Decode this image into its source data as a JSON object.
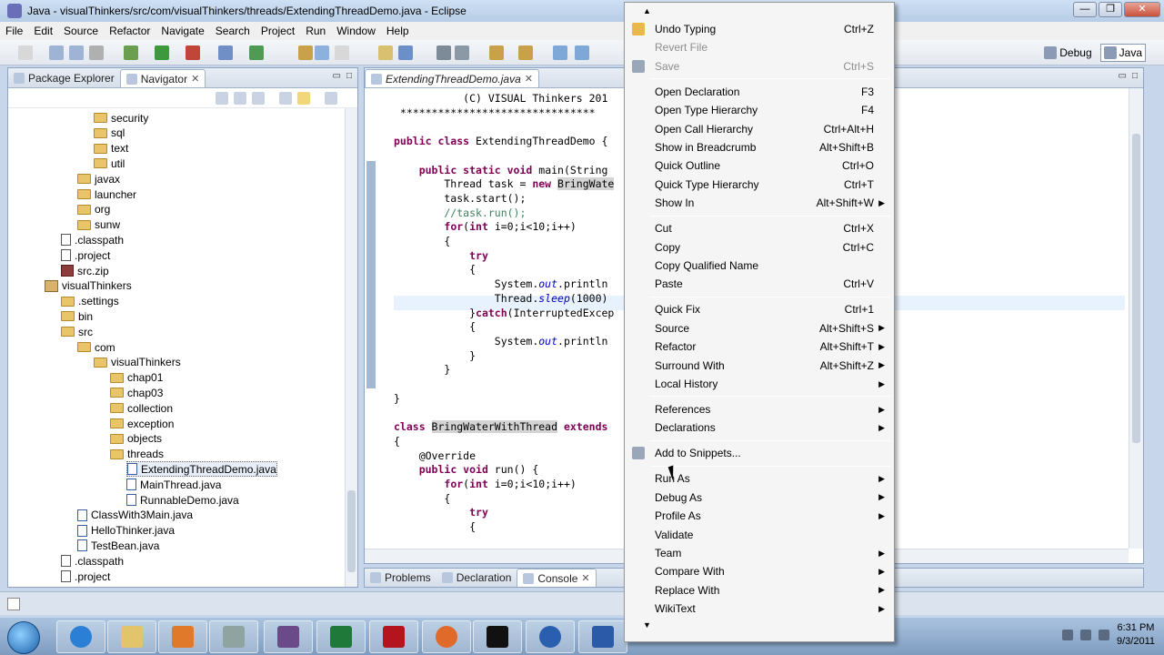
{
  "window": {
    "title": "Java - visualThinkers/src/com/visualThinkers/threads/ExtendingThreadDemo.java - Eclipse",
    "min": "—",
    "max": "❐",
    "close": "✕"
  },
  "menubar": [
    "File",
    "Edit",
    "Source",
    "Refactor",
    "Navigate",
    "Search",
    "Project",
    "Run",
    "Window",
    "Help"
  ],
  "perspectives": {
    "debug": "Debug",
    "java": "Java"
  },
  "left_panel": {
    "tabs": [
      {
        "label": "Package Explorer",
        "active": false
      },
      {
        "label": "Navigator",
        "active": true
      }
    ],
    "tree": [
      {
        "label": "security",
        "type": "folder",
        "indent": 4
      },
      {
        "label": "sql",
        "type": "folder",
        "indent": 4
      },
      {
        "label": "text",
        "type": "folder",
        "indent": 4
      },
      {
        "label": "util",
        "type": "folder",
        "indent": 4
      },
      {
        "label": "javax",
        "type": "folder",
        "indent": 3
      },
      {
        "label": "launcher",
        "type": "folder",
        "indent": 3
      },
      {
        "label": "org",
        "type": "folder",
        "indent": 3
      },
      {
        "label": "sunw",
        "type": "folder",
        "indent": 3
      },
      {
        "label": ".classpath",
        "type": "file",
        "indent": 2
      },
      {
        "label": ".project",
        "type": "file",
        "indent": 2
      },
      {
        "label": "src.zip",
        "type": "zip",
        "indent": 2
      },
      {
        "label": "visualThinkers",
        "type": "project",
        "indent": 1
      },
      {
        "label": ".settings",
        "type": "folder",
        "indent": 2
      },
      {
        "label": "bin",
        "type": "folder",
        "indent": 2
      },
      {
        "label": "src",
        "type": "folder",
        "indent": 2
      },
      {
        "label": "com",
        "type": "folder",
        "indent": 3
      },
      {
        "label": "visualThinkers",
        "type": "folder",
        "indent": 4
      },
      {
        "label": "chap01",
        "type": "folder",
        "indent": 5
      },
      {
        "label": "chap03",
        "type": "folder",
        "indent": 5
      },
      {
        "label": "collection",
        "type": "folder",
        "indent": 5
      },
      {
        "label": "exception",
        "type": "folder",
        "indent": 5
      },
      {
        "label": "objects",
        "type": "folder",
        "indent": 5
      },
      {
        "label": "threads",
        "type": "folder",
        "indent": 5
      },
      {
        "label": "ExtendingThreadDemo.java",
        "type": "java",
        "indent": 6,
        "selected": true
      },
      {
        "label": "MainThread.java",
        "type": "java",
        "indent": 6
      },
      {
        "label": "RunnableDemo.java",
        "type": "java",
        "indent": 6
      },
      {
        "label": "ClassWith3Main.java",
        "type": "java",
        "indent": 3
      },
      {
        "label": "HelloThinker.java",
        "type": "java",
        "indent": 3
      },
      {
        "label": "TestBean.java",
        "type": "java",
        "indent": 3
      },
      {
        "label": ".classpath",
        "type": "file",
        "indent": 2
      },
      {
        "label": ".project",
        "type": "file",
        "indent": 2
      }
    ]
  },
  "editor": {
    "tab": "ExtendingThreadDemo.java",
    "lines": [
      [
        {
          "t": "           (C) VISUAL Thinkers 201",
          "c": ""
        }
      ],
      [
        {
          "t": " *******************************",
          "c": ""
        }
      ],
      [],
      [
        {
          "t": "public class ",
          "c": "kw"
        },
        {
          "t": "ExtendingThreadDemo {",
          "c": ""
        }
      ],
      [],
      [
        {
          "t": "    ",
          "c": ""
        },
        {
          "t": "public static void ",
          "c": "kw"
        },
        {
          "t": "main(String",
          "c": ""
        }
      ],
      [
        {
          "t": "        Thread task = ",
          "c": ""
        },
        {
          "t": "new ",
          "c": "kw"
        },
        {
          "t": "BringWate",
          "c": "hl"
        }
      ],
      [
        {
          "t": "        task.start();",
          "c": ""
        }
      ],
      [
        {
          "t": "        //task.run();",
          "c": "cm"
        }
      ],
      [
        {
          "t": "        ",
          "c": ""
        },
        {
          "t": "for",
          "c": "kw"
        },
        {
          "t": "(",
          "c": ""
        },
        {
          "t": "int ",
          "c": "kw"
        },
        {
          "t": "i=0;i<10;i++)",
          "c": ""
        }
      ],
      [
        {
          "t": "        {",
          "c": ""
        }
      ],
      [
        {
          "t": "            ",
          "c": ""
        },
        {
          "t": "try",
          "c": "kw"
        }
      ],
      [
        {
          "t": "            {",
          "c": ""
        }
      ],
      [
        {
          "t": "                System.",
          "c": ""
        },
        {
          "t": "out",
          "c": "fld"
        },
        {
          "t": ".println",
          "c": ""
        }
      ],
      [
        {
          "t": "                Thread.",
          "c": ""
        },
        {
          "t": "sleep",
          "c": "fld"
        },
        {
          "t": "(1000)",
          "c": ""
        }
      ],
      [
        {
          "t": "            }",
          "c": ""
        },
        {
          "t": "catch",
          "c": "kw"
        },
        {
          "t": "(InterruptedExcep",
          "c": ""
        }
      ],
      [
        {
          "t": "            {",
          "c": ""
        }
      ],
      [
        {
          "t": "                System.",
          "c": ""
        },
        {
          "t": "out",
          "c": "fld"
        },
        {
          "t": ".println",
          "c": ""
        }
      ],
      [
        {
          "t": "            }",
          "c": ""
        }
      ],
      [
        {
          "t": "        }",
          "c": ""
        }
      ],
      [],
      [
        {
          "t": "}",
          "c": ""
        }
      ],
      [],
      [
        {
          "t": "class ",
          "c": "kw"
        },
        {
          "t": "BringWaterWithThread",
          "c": "hl"
        },
        {
          "t": " ",
          "c": ""
        },
        {
          "t": "extends",
          "c": "kw"
        }
      ],
      [
        {
          "t": "{",
          "c": ""
        }
      ],
      [
        {
          "t": "    @Override",
          "c": ""
        }
      ],
      [
        {
          "t": "    ",
          "c": ""
        },
        {
          "t": "public void ",
          "c": "kw"
        },
        {
          "t": "run() {",
          "c": ""
        }
      ],
      [
        {
          "t": "        ",
          "c": ""
        },
        {
          "t": "for",
          "c": "kw"
        },
        {
          "t": "(",
          "c": ""
        },
        {
          "t": "int ",
          "c": "kw"
        },
        {
          "t": "i=0;i<10;i++)",
          "c": ""
        }
      ],
      [
        {
          "t": "        {",
          "c": ""
        }
      ],
      [
        {
          "t": "            ",
          "c": ""
        },
        {
          "t": "try",
          "c": "kw"
        }
      ],
      [
        {
          "t": "            {",
          "c": ""
        }
      ]
    ]
  },
  "bottom_panel": {
    "tabs": [
      {
        "label": "Problems"
      },
      {
        "label": "Declaration"
      },
      {
        "label": "Console",
        "active": true
      }
    ]
  },
  "context_menu": {
    "top_arrow": "▲",
    "bottom_arrow": "▼",
    "groups": [
      [
        {
          "label": "Undo Typing",
          "shortcut": "Ctrl+Z",
          "icon": "undo-icon"
        },
        {
          "label": "Revert File",
          "disabled": true
        },
        {
          "label": "Save",
          "shortcut": "Ctrl+S",
          "disabled": true,
          "icon": "save-icon"
        }
      ],
      [
        {
          "label": "Open Declaration",
          "shortcut": "F3"
        },
        {
          "label": "Open Type Hierarchy",
          "shortcut": "F4"
        },
        {
          "label": "Open Call Hierarchy",
          "shortcut": "Ctrl+Alt+H"
        },
        {
          "label": "Show in Breadcrumb",
          "shortcut": "Alt+Shift+B"
        },
        {
          "label": "Quick Outline",
          "shortcut": "Ctrl+O"
        },
        {
          "label": "Quick Type Hierarchy",
          "shortcut": "Ctrl+T"
        },
        {
          "label": "Show In",
          "shortcut": "Alt+Shift+W",
          "submenu": true
        }
      ],
      [
        {
          "label": "Cut",
          "shortcut": "Ctrl+X"
        },
        {
          "label": "Copy",
          "shortcut": "Ctrl+C"
        },
        {
          "label": "Copy Qualified Name"
        },
        {
          "label": "Paste",
          "shortcut": "Ctrl+V"
        }
      ],
      [
        {
          "label": "Quick Fix",
          "shortcut": "Ctrl+1"
        },
        {
          "label": "Source",
          "shortcut": "Alt+Shift+S",
          "submenu": true
        },
        {
          "label": "Refactor",
          "shortcut": "Alt+Shift+T",
          "submenu": true
        },
        {
          "label": "Surround With",
          "shortcut": "Alt+Shift+Z",
          "submenu": true
        },
        {
          "label": "Local History",
          "submenu": true
        }
      ],
      [
        {
          "label": "References",
          "submenu": true
        },
        {
          "label": "Declarations",
          "submenu": true
        }
      ],
      [
        {
          "label": "Add to Snippets...",
          "icon": "snippet-icon"
        }
      ],
      [
        {
          "label": "Run As",
          "submenu": true
        },
        {
          "label": "Debug As",
          "submenu": true
        },
        {
          "label": "Profile As",
          "submenu": true
        },
        {
          "label": "Validate"
        },
        {
          "label": "Team",
          "submenu": true
        },
        {
          "label": "Compare With",
          "submenu": true
        },
        {
          "label": "Replace With",
          "submenu": true
        },
        {
          "label": "WikiText",
          "submenu": true
        }
      ]
    ]
  },
  "taskbar": {
    "time": "6:31 PM",
    "date": "9/3/2011"
  }
}
